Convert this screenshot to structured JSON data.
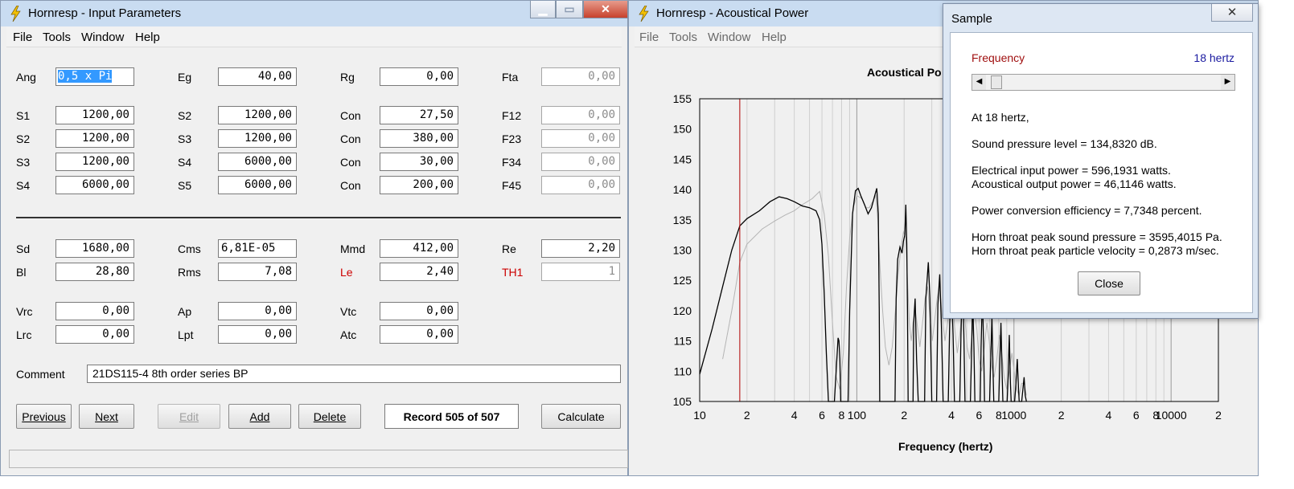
{
  "input_window": {
    "title": "Hornresp - Input Parameters",
    "menu": [
      "File",
      "Tools",
      "Window",
      "Help"
    ],
    "params": {
      "ang": {
        "label": "Ang",
        "value": "0,5 x Pi"
      },
      "eg": {
        "label": "Eg",
        "value": "40,00"
      },
      "rg": {
        "label": "Rg",
        "value": "0,00"
      },
      "fta": {
        "label": "Fta",
        "value": "0,00"
      },
      "row_s1": {
        "l1": "S1",
        "v1": "1200,00",
        "l2": "S2",
        "v2": "1200,00",
        "l3": "Con",
        "v3": "27,50",
        "l4": "F12",
        "v4": "0,00"
      },
      "row_s2": {
        "l1": "S2",
        "v1": "1200,00",
        "l2": "S3",
        "v2": "1200,00",
        "l3": "Con",
        "v3": "380,00",
        "l4": "F23",
        "v4": "0,00"
      },
      "row_s3": {
        "l1": "S3",
        "v1": "1200,00",
        "l2": "S4",
        "v2": "6000,00",
        "l3": "Con",
        "v3": "30,00",
        "l4": "F34",
        "v4": "0,00"
      },
      "row_s4": {
        "l1": "S4",
        "v1": "6000,00",
        "l2": "S5",
        "v2": "6000,00",
        "l3": "Con",
        "v3": "200,00",
        "l4": "F45",
        "v4": "0,00"
      },
      "sd": {
        "label": "Sd",
        "value": "1680,00"
      },
      "cms": {
        "label": "Cms",
        "value": "6,81E-05"
      },
      "mmd": {
        "label": "Mmd",
        "value": "412,00"
      },
      "re": {
        "label": "Re",
        "value": "2,20"
      },
      "bl": {
        "label": "Bl",
        "value": "28,80"
      },
      "rms": {
        "label": "Rms",
        "value": "7,08"
      },
      "le": {
        "label": "Le",
        "value": "2,40"
      },
      "th1": {
        "label": "TH1",
        "value": "1"
      },
      "vrc": {
        "label": "Vrc",
        "value": "0,00"
      },
      "ap": {
        "label": "Ap",
        "value": "0,00"
      },
      "vtc": {
        "label": "Vtc",
        "value": "0,00"
      },
      "lrc": {
        "label": "Lrc",
        "value": "0,00"
      },
      "lpt": {
        "label": "Lpt",
        "value": "0,00"
      },
      "atc": {
        "label": "Atc",
        "value": "0,00"
      }
    },
    "comment_label": "Comment",
    "comment_value": "21DS115-4 8th order series BP",
    "buttons": {
      "previous": "Previous",
      "next": "Next",
      "edit": "Edit",
      "add": "Add",
      "delete": "Delete",
      "calculate": "Calculate"
    },
    "record": "Record 505 of 507",
    "colors": {
      "warning_label": "#cc0000",
      "selection": "#3399ff"
    }
  },
  "power_window": {
    "title": "Hornresp - Acoustical Power",
    "menu": [
      "File",
      "Tools",
      "Window",
      "Help"
    ]
  },
  "chart_data": {
    "type": "line",
    "title": "Acoustical Po",
    "xlabel": "Frequency (hertz)",
    "ylabel": "",
    "x_scale": "log",
    "xlim": [
      10,
      20000
    ],
    "ylim": [
      105,
      155
    ],
    "x_ticks": [
      10,
      20,
      40,
      60,
      80,
      100,
      200,
      400,
      600,
      800,
      1000,
      2000,
      4000,
      6000,
      8000,
      10000,
      20000
    ],
    "x_tick_labels": [
      "10",
      "2",
      "4",
      "6",
      "8",
      "100",
      "2",
      "4",
      "6",
      "8",
      "1000",
      "2",
      "4",
      "6",
      "8",
      "10000",
      "2"
    ],
    "y_ticks": [
      105,
      110,
      115,
      120,
      125,
      130,
      135,
      140,
      145,
      150,
      155
    ],
    "grid": true,
    "marker_frequency": 18,
    "marker_color": "#b00000",
    "series": [
      {
        "color": "#000000",
        "points": [
          [
            10,
            109.5
          ],
          [
            12,
            117
          ],
          [
            14,
            124
          ],
          [
            16,
            130
          ],
          [
            18,
            134
          ],
          [
            20,
            135.2
          ],
          [
            24,
            136.5
          ],
          [
            28,
            138
          ],
          [
            32,
            138.8
          ],
          [
            36,
            138.5
          ],
          [
            40,
            138
          ],
          [
            45,
            137.3
          ],
          [
            50,
            137
          ],
          [
            55,
            136.5
          ],
          [
            58,
            135
          ],
          [
            60,
            131
          ],
          [
            62,
            123
          ],
          [
            64,
            113
          ],
          [
            66,
            105
          ],
          [
            72,
            105
          ],
          [
            75,
            113
          ],
          [
            76,
            115.5
          ],
          [
            77,
            115
          ],
          [
            78,
            112
          ],
          [
            79,
            105
          ],
          [
            88,
            105
          ],
          [
            90,
            120
          ],
          [
            94,
            136
          ],
          [
            98,
            139.8
          ],
          [
            102,
            140.2
          ],
          [
            106,
            139
          ],
          [
            112,
            137.5
          ],
          [
            118,
            136
          ],
          [
            124,
            137
          ],
          [
            130,
            139
          ],
          [
            134,
            140.2
          ],
          [
            137,
            136
          ],
          [
            139,
            120
          ],
          [
            140,
            105
          ],
          [
            175,
            105
          ],
          [
            178,
            122
          ],
          [
            182,
            128.5
          ],
          [
            188,
            130.5
          ],
          [
            194,
            129.5
          ],
          [
            198,
            131.5
          ],
          [
            202,
            132.5
          ],
          [
            205,
            137.5
          ],
          [
            208,
            131
          ],
          [
            210,
            120
          ],
          [
            212,
            105
          ],
          [
            228,
            105
          ],
          [
            230,
            118
          ],
          [
            235,
            122
          ],
          [
            240,
            112
          ],
          [
            246,
            105
          ],
          [
            270,
            105
          ],
          [
            275,
            122
          ],
          [
            285,
            128
          ],
          [
            292,
            122
          ],
          [
            300,
            105
          ],
          [
            322,
            105
          ],
          [
            328,
            121
          ],
          [
            337,
            126
          ],
          [
            346,
            117
          ],
          [
            354,
            105
          ],
          [
            382,
            105
          ],
          [
            390,
            118
          ],
          [
            400,
            124
          ],
          [
            410,
            116
          ],
          [
            418,
            105
          ],
          [
            452,
            105
          ],
          [
            460,
            116
          ],
          [
            470,
            125
          ],
          [
            480,
            116
          ],
          [
            488,
            105
          ],
          [
            528,
            105
          ],
          [
            536,
            112
          ],
          [
            546,
            122
          ],
          [
            556,
            114
          ],
          [
            564,
            105
          ],
          [
            610,
            105
          ],
          [
            618,
            114
          ],
          [
            630,
            123
          ],
          [
            642,
            113
          ],
          [
            650,
            105
          ],
          [
            700,
            105
          ],
          [
            710,
            111
          ],
          [
            724,
            119
          ],
          [
            736,
            110
          ],
          [
            744,
            105
          ],
          [
            800,
            105
          ],
          [
            812,
            111
          ],
          [
            826,
            118
          ],
          [
            840,
            110
          ],
          [
            850,
            105
          ],
          [
            905,
            105
          ],
          [
            918,
            109
          ],
          [
            934,
            116
          ],
          [
            950,
            108
          ],
          [
            960,
            105
          ],
          [
            1010,
            105
          ],
          [
            1030,
            108
          ],
          [
            1050,
            112
          ],
          [
            1070,
            107
          ],
          [
            1080,
            105
          ],
          [
            1120,
            105
          ],
          [
            1140,
            107
          ],
          [
            1160,
            109
          ],
          [
            1180,
            106
          ],
          [
            1200,
            105
          ]
        ]
      },
      {
        "color": "#b4b4b4",
        "points": [
          [
            14,
            112
          ],
          [
            16,
            120
          ],
          [
            18,
            128
          ],
          [
            20,
            131
          ],
          [
            25,
            133.5
          ],
          [
            30,
            134.8
          ],
          [
            35,
            135.8
          ],
          [
            40,
            136.5
          ],
          [
            45,
            137.5
          ],
          [
            52,
            138.5
          ],
          [
            58,
            139.7
          ],
          [
            62,
            136
          ],
          [
            66,
            129
          ],
          [
            70,
            118
          ],
          [
            74,
            109
          ],
          [
            78,
            107
          ],
          [
            82,
            113
          ],
          [
            86,
            124
          ],
          [
            90,
            132
          ],
          [
            95,
            137
          ],
          [
            100,
            139
          ],
          [
            108,
            138.5
          ],
          [
            114,
            137
          ],
          [
            120,
            137
          ],
          [
            126,
            138
          ],
          [
            132,
            139
          ],
          [
            136,
            135
          ],
          [
            140,
            128
          ],
          [
            146,
            120
          ],
          [
            152,
            114
          ],
          [
            160,
            111
          ],
          [
            168,
            114
          ],
          [
            176,
            120
          ],
          [
            182,
            125
          ],
          [
            190,
            130
          ],
          [
            198,
            133
          ],
          [
            205,
            132
          ],
          [
            210,
            125
          ],
          [
            216,
            118
          ],
          [
            222,
            115
          ],
          [
            228,
            118
          ],
          [
            236,
            120
          ],
          [
            244,
            117
          ],
          [
            252,
            114
          ],
          [
            262,
            118
          ],
          [
            272,
            122
          ],
          [
            282,
            124
          ],
          [
            292,
            119
          ],
          [
            302,
            115
          ],
          [
            312,
            118
          ],
          [
            324,
            122
          ],
          [
            336,
            124
          ],
          [
            350,
            119
          ],
          [
            364,
            115
          ],
          [
            378,
            118
          ],
          [
            392,
            121
          ],
          [
            406,
            122
          ],
          [
            420,
            117
          ],
          [
            436,
            113
          ],
          [
            452,
            116
          ],
          [
            470,
            121
          ],
          [
            486,
            119
          ],
          [
            504,
            114
          ],
          [
            522,
            112
          ],
          [
            542,
            116
          ],
          [
            560,
            120
          ],
          [
            580,
            117
          ],
          [
            600,
            112
          ],
          [
            624,
            110
          ],
          [
            648,
            114
          ],
          [
            672,
            118
          ],
          [
            696,
            115
          ],
          [
            720,
            111
          ],
          [
            748,
            109
          ],
          [
            778,
            112
          ],
          [
            808,
            116
          ],
          [
            836,
            113
          ],
          [
            866,
            109
          ],
          [
            900,
            107
          ],
          [
            936,
            110
          ],
          [
            970,
            113
          ],
          [
            1004,
            110
          ],
          [
            1040,
            107
          ],
          [
            1080,
            106
          ],
          [
            1120,
            108
          ],
          [
            1160,
            108
          ],
          [
            1200,
            106
          ]
        ]
      }
    ]
  },
  "sample_dialog": {
    "title": "Sample",
    "close_glyph": "✕",
    "frequency_label": "Frequency",
    "frequency_value": "18 hertz",
    "slider_fraction": 0.02,
    "lines": {
      "at": "At 18 hertz,",
      "spl": "Sound pressure level = 134,8320 dB.",
      "elec": "Electrical input power = 596,1931 watts.",
      "acou": "Acoustical output power = 46,1146 watts.",
      "eff": "Power conversion efficiency = 7,7348 percent.",
      "throat_p": "Horn throat peak sound pressure = 3595,4015 Pa.",
      "throat_v": "Horn throat peak particle velocity = 0,2873 m/sec."
    },
    "close_button": "Close",
    "colors": {
      "frequency_label": "#a01010",
      "frequency_value": "#1a1aa0"
    }
  }
}
